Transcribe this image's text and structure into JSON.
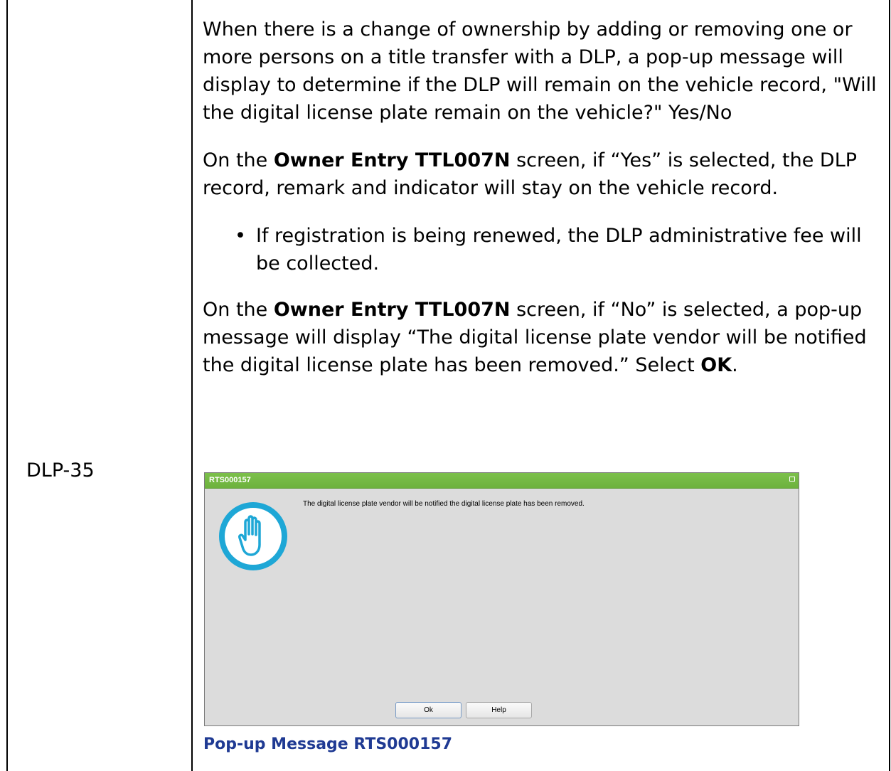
{
  "row_id": "DLP-35",
  "content": {
    "para1": "When there is a change of ownership by adding or removing one or more persons on a title transfer with a DLP, a pop-up message will display to determine if the DLP will remain on the vehicle record, \"Will the digital license plate remain on the vehicle?\" Yes/No",
    "para2_prefix": "On the ",
    "screen_name": "Owner Entry TTL007N",
    "para2_suffix": " screen, if “Yes” is selected, the DLP record, remark and indicator will stay on the vehicle record.",
    "bullet1": "If registration is being renewed, the DLP administrative fee will be collected.",
    "para3_prefix": "On the ",
    "para3_suffix": " screen, if “No” is selected, a pop-up message will display “The digital license plate vendor will be notified the digital license plate has been removed.” Select ",
    "para3_ok": "OK",
    "para3_end": "."
  },
  "dialog": {
    "title": "RTS000157",
    "message": "The digital license plate vendor will be notified the digital license plate has been removed.",
    "icon": "stop-hand-icon",
    "ok_label": "Ok",
    "help_label": "Help",
    "titlebar_color": "#72b642",
    "icon_color": "#1ea7d6"
  },
  "caption": "Pop-up Message RTS000157"
}
